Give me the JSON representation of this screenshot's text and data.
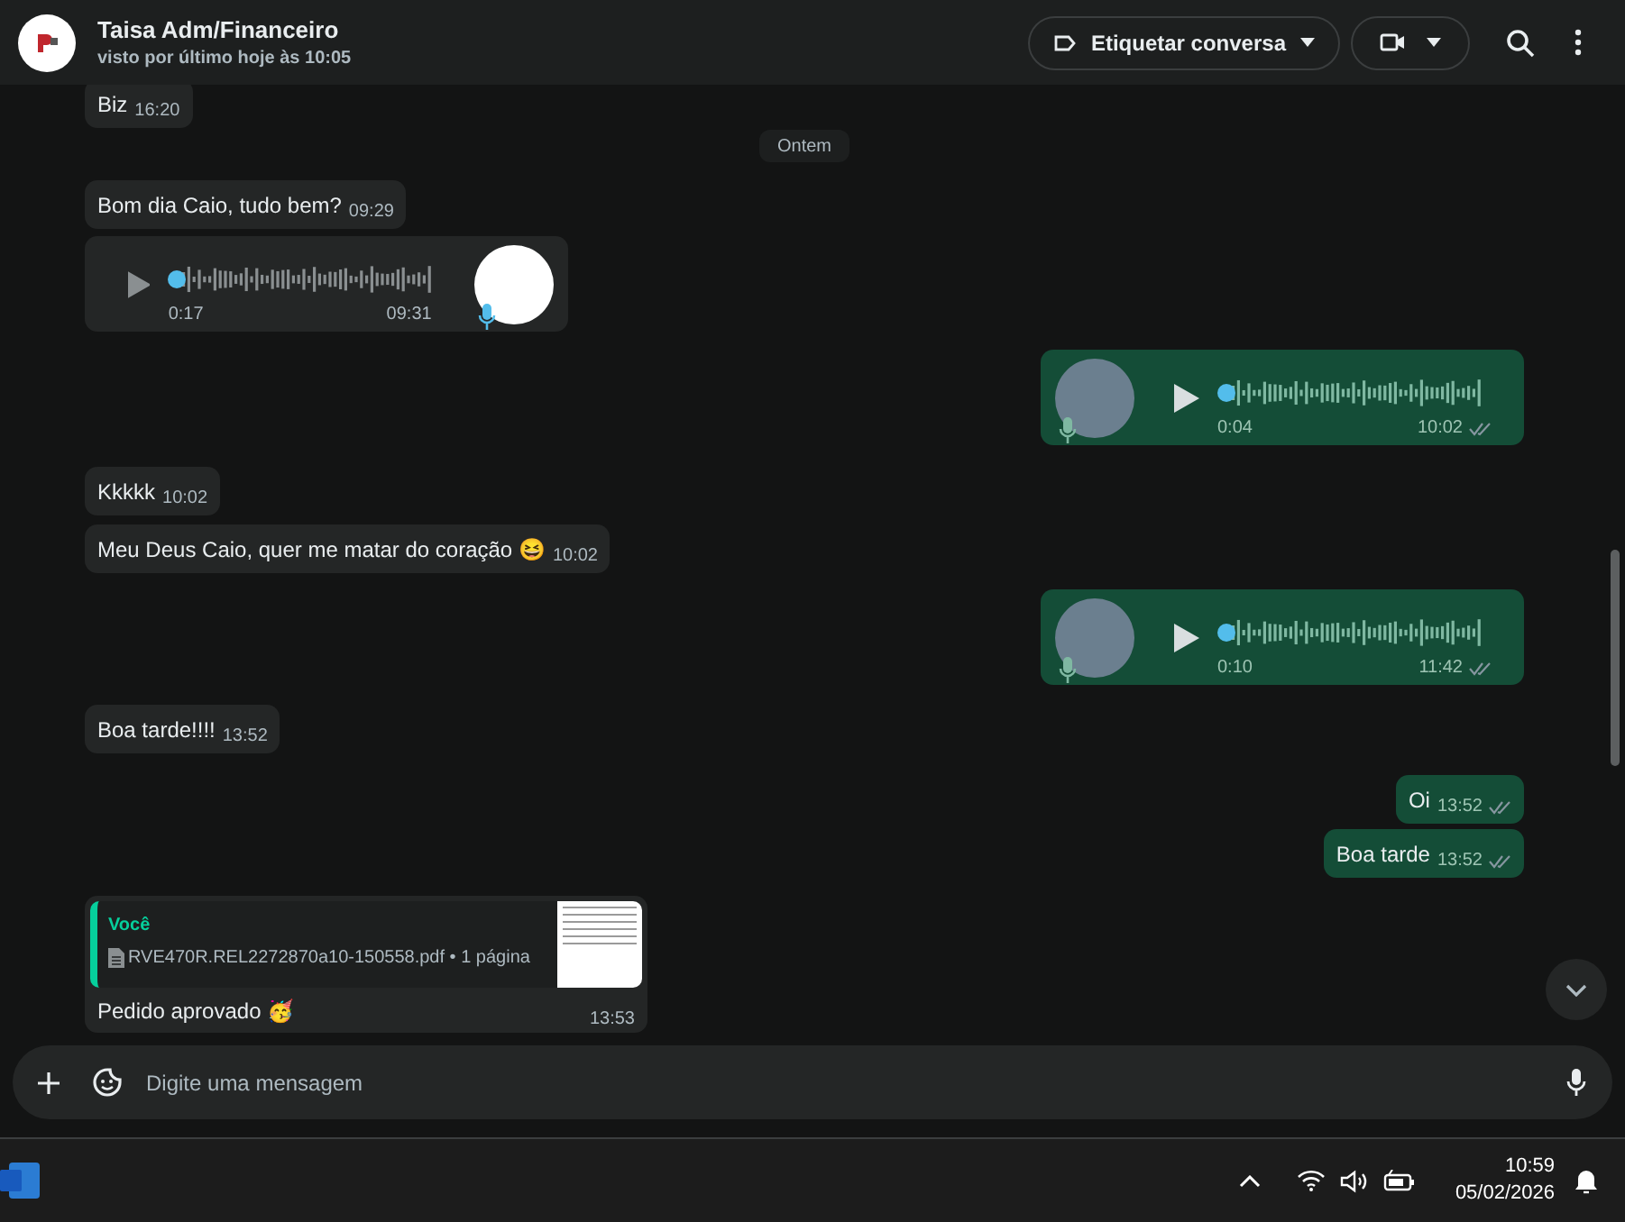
{
  "header": {
    "title": "Taisa Adm/Financeiro",
    "subtitle": "visto por último hoje às 10:05",
    "label_button": "Etiquetar conversa"
  },
  "messages": [
    {
      "kind": "text",
      "out": false,
      "text": "Biz",
      "time": "16:20"
    },
    {
      "kind": "date",
      "text": "Ontem"
    },
    {
      "kind": "text",
      "out": false,
      "text": "Bom dia Caio, tudo bem?",
      "time": "09:29"
    },
    {
      "kind": "audio",
      "out": false,
      "duration": "0:17",
      "time": "09:31"
    },
    {
      "kind": "audio",
      "out": true,
      "duration": "0:04",
      "time": "10:02",
      "read": false
    },
    {
      "kind": "text",
      "out": false,
      "text": "Kkkkk",
      "time": "10:02"
    },
    {
      "kind": "text",
      "out": false,
      "text": "Meu Deus Caio, quer me matar do coração 😆",
      "time": "10:02"
    },
    {
      "kind": "audio",
      "out": true,
      "duration": "0:10",
      "time": "11:42",
      "read": false
    },
    {
      "kind": "text",
      "out": false,
      "text": "Boa tarde!!!!",
      "time": "13:52"
    },
    {
      "kind": "text",
      "out": true,
      "text": "Oi",
      "time": "13:52",
      "read": false
    },
    {
      "kind": "text",
      "out": true,
      "text": "Boa tarde",
      "time": "13:52",
      "read": false
    },
    {
      "kind": "reply",
      "out": false,
      "quote_author": "Você",
      "quote_file": "RVE470R.REL2272870a10-150558.pdf • 1 página",
      "text": "Pedido aprovado 🥳",
      "time": "13:53"
    }
  ],
  "composer": {
    "placeholder": "Digite uma mensagem"
  },
  "taskbar": {
    "time": "10:59",
    "date": "05/02/2026"
  }
}
